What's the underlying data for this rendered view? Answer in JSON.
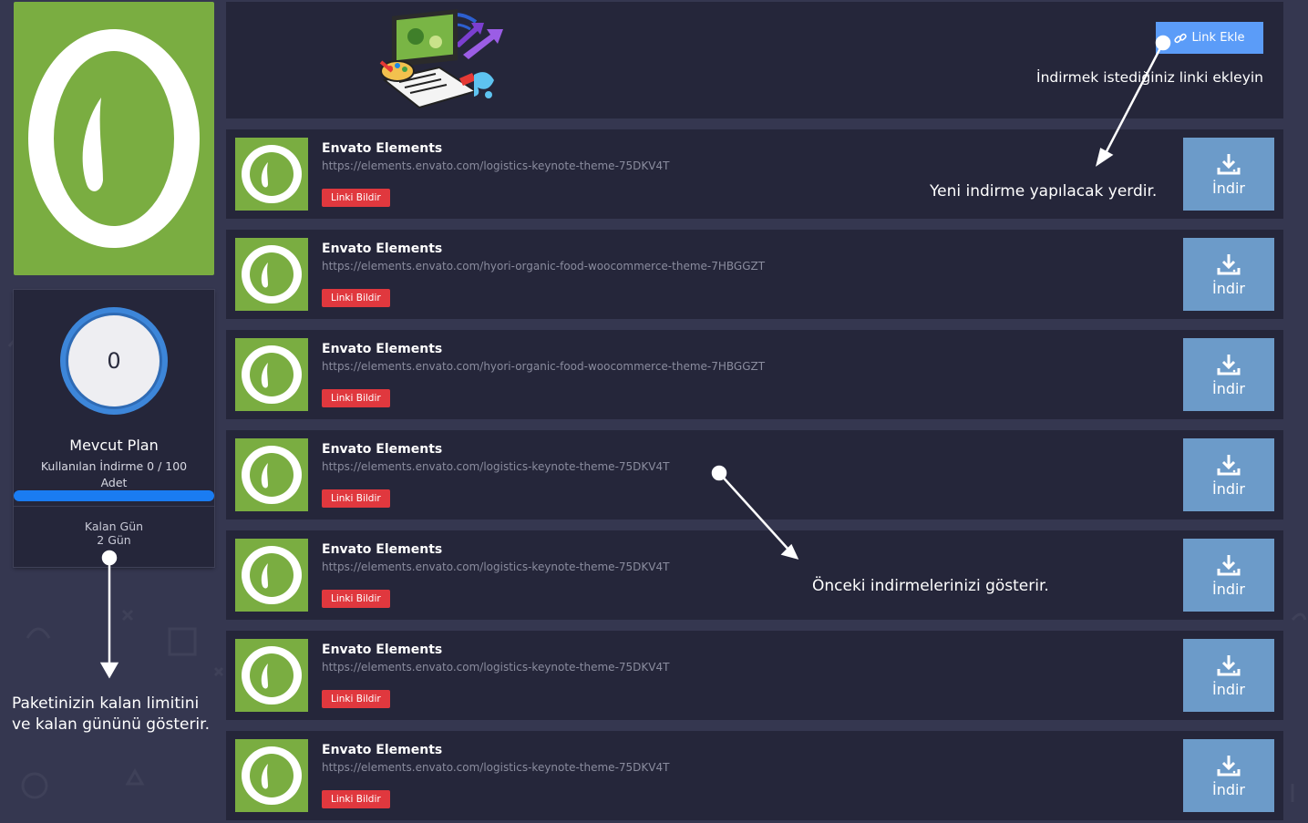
{
  "sidebar": {
    "gauge_value": "0",
    "plan_title": "Mevcut Plan",
    "used_line1": "Kullanılan İndirme 0 / 100",
    "used_line2": "Adet",
    "days_label": "Kalan Gün",
    "days_value": "2 Gün"
  },
  "header": {
    "add_link_label": "Link Ekle",
    "add_link_hint": "İndirmek istediğiniz linki ekleyin"
  },
  "downloads": [
    {
      "title": "Envato Elements",
      "url": "https://elements.envato.com/logistics-keynote-theme-75DKV4T",
      "report": "Linki Bildir",
      "download": "İndir"
    },
    {
      "title": "Envato Elements",
      "url": "https://elements.envato.com/hyori-organic-food-woocommerce-theme-7HBGGZT",
      "report": "Linki Bildir",
      "download": "İndir"
    },
    {
      "title": "Envato Elements",
      "url": "https://elements.envato.com/hyori-organic-food-woocommerce-theme-7HBGGZT",
      "report": "Linki Bildir",
      "download": "İndir"
    },
    {
      "title": "Envato Elements",
      "url": "https://elements.envato.com/logistics-keynote-theme-75DKV4T",
      "report": "Linki Bildir",
      "download": "İndir"
    },
    {
      "title": "Envato Elements",
      "url": "https://elements.envato.com/logistics-keynote-theme-75DKV4T",
      "report": "Linki Bildir",
      "download": "İndir"
    },
    {
      "title": "Envato Elements",
      "url": "https://elements.envato.com/logistics-keynote-theme-75DKV4T",
      "report": "Linki Bildir",
      "download": "İndir"
    },
    {
      "title": "Envato Elements",
      "url": "https://elements.envato.com/logistics-keynote-theme-75DKV4T",
      "report": "Linki Bildir",
      "download": "İndir"
    }
  ],
  "annotations": {
    "new_download": "Yeni indirme yapılacak yerdir.",
    "previous_downloads": "Önceki indirmelerinizi gösterir.",
    "package_line1": "Paketinizin kalan limitini",
    "package_line2": "ve kalan gününü gösterir."
  },
  "colors": {
    "background": "#353750",
    "panel": "#25263a",
    "brand_green": "#7aad41",
    "primary_blue": "#5b9cf8",
    "download_blue": "#6c9bc9",
    "report_red": "#e0383e",
    "progress_blue": "#1a7cf2"
  },
  "icons": {
    "add_link": "link-icon",
    "download": "download-tray-icon",
    "brand": "envato-leaf-icon",
    "hero": "design-laptop-illustration"
  }
}
